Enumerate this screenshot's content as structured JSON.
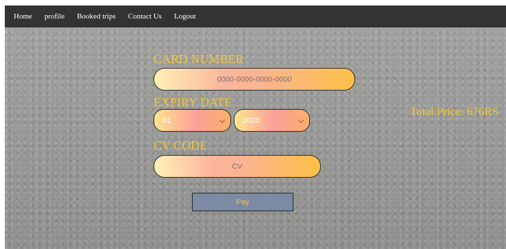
{
  "nav": {
    "items": [
      {
        "label": "Home"
      },
      {
        "label": "profile"
      },
      {
        "label": "Booked trips"
      },
      {
        "label": "Contact Us"
      },
      {
        "label": "Logout"
      }
    ]
  },
  "form": {
    "card_number": {
      "label": "CARD NUMBER",
      "placeholder": "0000-0000-0000-0000",
      "value": ""
    },
    "expiry_date": {
      "label": "EXPIRY DATE",
      "month_selected": "01",
      "year_selected": "2020"
    },
    "cv_code": {
      "label": "CV CODE",
      "placeholder": "CV",
      "value": ""
    },
    "pay_label": "Pay"
  },
  "summary": {
    "total_price": "Total Price: 676RS"
  },
  "colors": {
    "accent_text": "#f0c63f",
    "navbar": "#333333",
    "pay_button": "#7c8ba3"
  },
  "icons": {
    "select_arrow": "chevron-down-icon"
  }
}
